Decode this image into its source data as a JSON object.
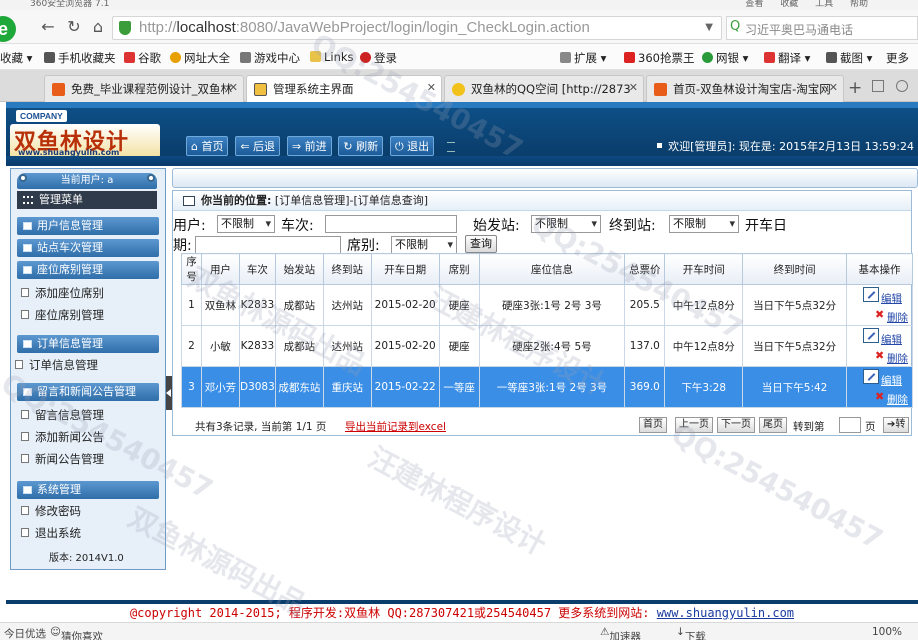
{
  "browser": {
    "app_title": "360安全浏览器 7.1",
    "top_menu": [
      "查看",
      "收藏",
      "工具",
      "帮助"
    ],
    "url_prefix": "http://",
    "url_host": "localhost",
    "url_path": ":8080/JavaWebProject/login/login_CheckLogin.action",
    "search_text": "习近平奥巴马通电话",
    "bookmarks": [
      "收藏",
      "手机收藏夹",
      "谷歌",
      "网址大全",
      "游戏中心",
      "Links",
      "登录",
      "扩展",
      "360抢票王",
      "网银",
      "翻译",
      "截图",
      "更多"
    ],
    "tabs": [
      {
        "label": "免费_毕业课程范例设计_双鱼林",
        "active": false
      },
      {
        "label": "管理系统主界面",
        "active": true
      },
      {
        "label": "双鱼林的QQ空间 [http://2873",
        "active": false
      },
      {
        "label": "首页-双鱼林设计淘宝店-淘宝网",
        "active": false
      }
    ],
    "status_left": "今日优选",
    "status_like": "猜你喜欢",
    "status_speed": "加速器",
    "status_download": "下载",
    "zoom": "100%"
  },
  "header": {
    "badge": "COMPANY",
    "logo_name": "双鱼林设计",
    "logo_domain": "www.shuangyulin.com",
    "nav": [
      "首页",
      "后退",
      "前进",
      "刷新",
      "退出"
    ],
    "welcome": "欢迎[管理员]:  现在是: 2015年2月13日 13:59:24"
  },
  "sidebar": {
    "current_user": "当前用户: a",
    "menu_title": "管理菜单",
    "groups": [
      {
        "label": "用户信息管理"
      },
      {
        "label": "站点车次管理"
      },
      {
        "label": "座位席别管理",
        "items": [
          "添加座位席别",
          "座位席别管理"
        ]
      },
      {
        "label": "订单信息管理",
        "items": [
          "订单信息管理"
        ]
      },
      {
        "label": "留言和新闻公告管理",
        "items": [
          "留言信息管理",
          "添加新闻公告",
          "新闻公告管理"
        ]
      },
      {
        "label": "系统管理",
        "items": [
          "修改密码",
          "退出系统"
        ]
      }
    ],
    "version": "版本: 2014V1.0"
  },
  "main": {
    "location_label": "你当前的位置:",
    "location_path": "[订单信息管理]-[订单信息查询]",
    "form": {
      "user_label": "用户:",
      "user_value": "不限制",
      "train_label": "车次:",
      "from_label": "始发站:",
      "from_value": "不限制",
      "to_label": "终到站:",
      "to_value": "不限制",
      "date_label_1": "开车日",
      "date_label_2": "期:",
      "seat_label": "席别:",
      "seat_value": "不限制",
      "query_button": "查询"
    },
    "columns": [
      "序号",
      "用户",
      "车次",
      "始发站",
      "终到站",
      "开车日期",
      "席别",
      "座位信息",
      "总票价",
      "开车时间",
      "终到时间",
      "基本操作"
    ],
    "rows": [
      {
        "no": "1",
        "user": "双鱼林",
        "train": "K2833",
        "from": "成都站",
        "to": "达州站",
        "date": "2015-02-20",
        "seat_type": "硬座",
        "seat_info": "硬座3张:1号 2号 3号",
        "price": "205.5",
        "depart": "中午12点8分",
        "arrive": "当日下午5点32分",
        "edit": "编辑",
        "delete": "删除"
      },
      {
        "no": "2",
        "user": "小敏",
        "train": "K2833",
        "from": "成都站",
        "to": "达州站",
        "date": "2015-02-20",
        "seat_type": "硬座",
        "seat_info": "硬座2张:4号 5号",
        "price": "137.0",
        "depart": "中午12点8分",
        "arrive": "当日下午5点32分",
        "edit": "编辑",
        "delete": "删除"
      },
      {
        "no": "3",
        "user": "邓小芳",
        "train": "D3083",
        "from": "成都东站",
        "to": "重庆站",
        "date": "2015-02-22",
        "seat_type": "一等座",
        "seat_info": "一等座3张:1号 2号 3号",
        "price": "369.0",
        "depart": "下午3:28",
        "arrive": "当日下午5:42",
        "edit": "编辑",
        "delete": "删除"
      }
    ],
    "pager": {
      "info": "共有3条记录, 当前第 1/1 页",
      "export": "导出当前记录到excel",
      "first": "首页",
      "prev": "上一页",
      "next": "下一页",
      "last": "尾页",
      "goto": "转到第",
      "unit": "页",
      "go": "转"
    }
  },
  "footer": {
    "text": "@copyright 2014-2015; 程序开发:双鱼林  QQ:287307421或254540457  更多系统到网站: ",
    "link": "www.shuangyulin.com"
  },
  "watermarks": [
    "QQ:254540457",
    "汪建林程序设计",
    "双鱼林源码出品"
  ],
  "colors": {
    "header_blue": "#0a3d6b",
    "selected_row": "#3a8ee6",
    "browser_green": "#1fa83a",
    "footer_red": "#cc0000"
  }
}
